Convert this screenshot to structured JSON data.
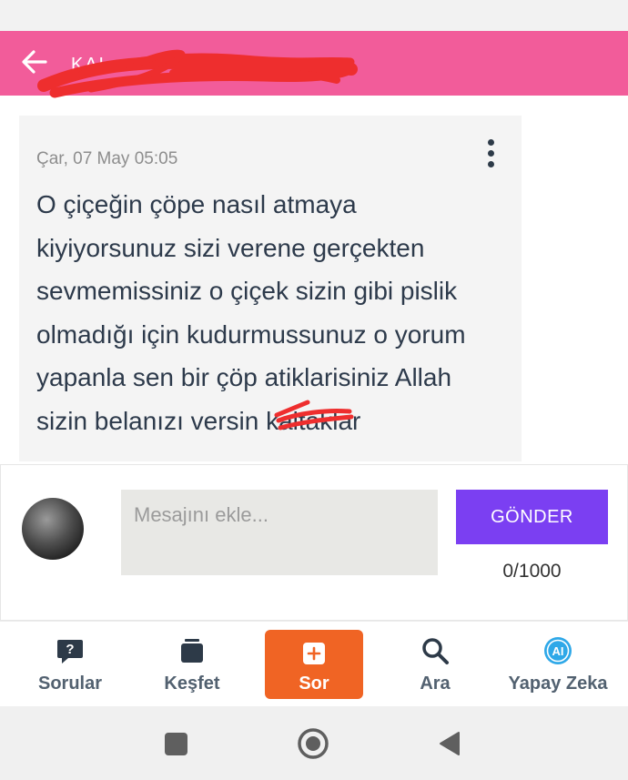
{
  "header": {
    "title": "KAL",
    "back_icon": "arrow-left-icon",
    "color": "#f25c9a"
  },
  "message": {
    "date": "Çar, 07 May 05:05",
    "lines": [
      "O çiçeğin çöpe nasıl atmaya",
      "kiyiyorsunuz sizi verene gerçekten",
      "sevmemissiniz o çiçek sizin gibi pislik",
      "olmadığı için kudurmussunuz o yorum",
      "yapanla sen bir çöp atiklarisiniz Allah",
      "sizin belanızı versin kaltaklar"
    ]
  },
  "composer": {
    "placeholder": "Mesajını ekle...",
    "value": "",
    "send_label": "GÖNDER",
    "counter": "0/1000",
    "send_color": "#7b3ff2"
  },
  "nav": {
    "items": [
      {
        "label": "Sorular",
        "icon": "question-bubble-icon"
      },
      {
        "label": "Keşfet",
        "icon": "cards-icon"
      },
      {
        "label": "Sor",
        "icon": "plus-square-icon"
      },
      {
        "label": "Ara",
        "icon": "search-icon"
      },
      {
        "label": "Yapay Zeka",
        "icon": "ai-badge-icon"
      }
    ],
    "ask_color": "#f06424"
  },
  "system_nav": {
    "icons": [
      "recents-square-icon",
      "home-circle-icon",
      "back-triangle-icon"
    ]
  }
}
